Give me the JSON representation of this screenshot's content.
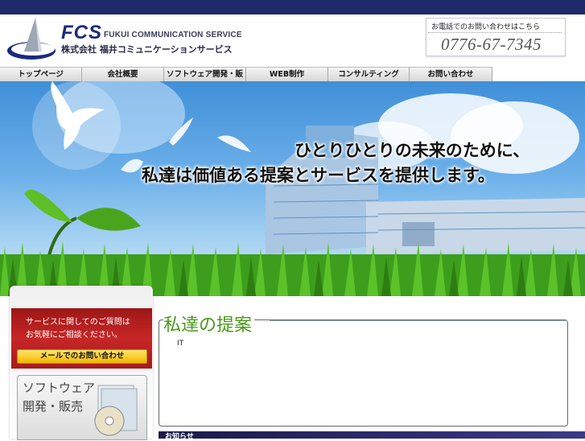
{
  "logo": {
    "mark": "fcs-logo",
    "abbr": "FCS",
    "name_en": "FUKUI COMMUNICATION SERVICE",
    "name_jp": "株式会社 福井コミュニケーションサービス"
  },
  "contact": {
    "label": "お電話でのお問い合わせはこちら",
    "phone": "0776-67-7345"
  },
  "nav": {
    "items": [
      {
        "label": "トップページ"
      },
      {
        "label": "会社概要"
      },
      {
        "label": "ソフトウェア開発・販売"
      },
      {
        "label": "WEB制作"
      },
      {
        "label": "コンサルティング"
      },
      {
        "label": "お問い合わせ"
      }
    ]
  },
  "hero": {
    "slogan_line1": "ひとりひとりの未来のために、",
    "slogan_line2": "私達は価値ある提案とサービスを提供します。"
  },
  "sidebar": {
    "inquiry_line1": "サービスに関してのご質問は",
    "inquiry_line2": "お気軽にご相談ください。",
    "mail_button": "メールでのお問い合わせ",
    "banner_line1": "ソフトウェア",
    "banner_line2": "開発・販売"
  },
  "main": {
    "title": "私達の提案",
    "body": "IT"
  },
  "news": {
    "label": "お知らせ"
  },
  "colors": {
    "navy": "#1d2a6b",
    "accent_green": "#4a9a1a",
    "inquiry_red": "#b01e1e",
    "button_yellow": "#f2c200"
  }
}
